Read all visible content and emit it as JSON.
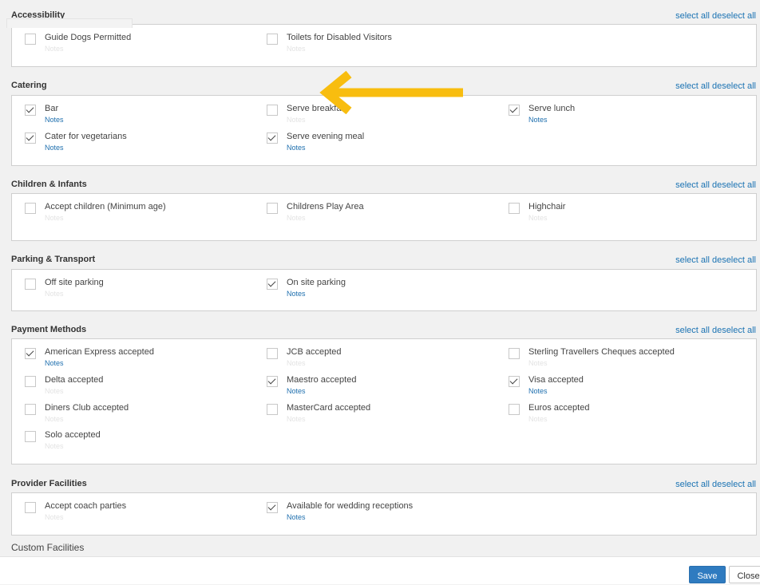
{
  "section_links": {
    "select_all": "select all",
    "deselect_all": "deselect all"
  },
  "notes_label": "Notes",
  "sections": [
    {
      "title": "Accessibility",
      "items": [
        {
          "label": "Guide Dogs Permitted",
          "checked": false
        },
        {
          "label": "Toilets for Disabled Visitors",
          "checked": false
        }
      ]
    },
    {
      "title": "Catering",
      "items": [
        {
          "label": "Bar",
          "checked": true
        },
        {
          "label": "Serve breakfast",
          "checked": false
        },
        {
          "label": "Serve lunch",
          "checked": true
        },
        {
          "label": "Cater for vegetarians",
          "checked": true
        },
        {
          "label": "Serve evening meal",
          "checked": true
        }
      ]
    },
    {
      "title": "Children & Infants",
      "items": [
        {
          "label": "Accept children (Minimum age)",
          "checked": false
        },
        {
          "label": "Childrens Play Area",
          "checked": false
        },
        {
          "label": "Highchair",
          "checked": false
        }
      ]
    },
    {
      "title": "Parking & Transport",
      "items": [
        {
          "label": "Off site parking",
          "checked": false
        },
        {
          "label": "On site parking",
          "checked": true
        }
      ]
    },
    {
      "title": "Payment Methods",
      "items": [
        {
          "label": "American Express accepted",
          "checked": true
        },
        {
          "label": "JCB accepted",
          "checked": false
        },
        {
          "label": "Sterling Travellers Cheques accepted",
          "checked": false
        },
        {
          "label": "Delta accepted",
          "checked": false
        },
        {
          "label": "Maestro accepted",
          "checked": true
        },
        {
          "label": "Visa accepted",
          "checked": true
        },
        {
          "label": "Diners Club accepted",
          "checked": false
        },
        {
          "label": "MasterCard accepted",
          "checked": false
        },
        {
          "label": "Euros accepted",
          "checked": false
        },
        {
          "label": "Solo accepted",
          "checked": false
        }
      ]
    },
    {
      "title": "Provider Facilities",
      "items": [
        {
          "label": "Accept coach parties",
          "checked": false
        },
        {
          "label": "Available for wedding receptions",
          "checked": true
        }
      ]
    }
  ],
  "custom_facilities_title": "Custom Facilities",
  "footer": {
    "save_label": "Save",
    "close_label": "Close"
  },
  "colors": {
    "link": "#1b73b3",
    "notes_active": "#1e6fae",
    "save_button": "#2f7bc0",
    "annotation_arrow": "#f8bd0f"
  }
}
